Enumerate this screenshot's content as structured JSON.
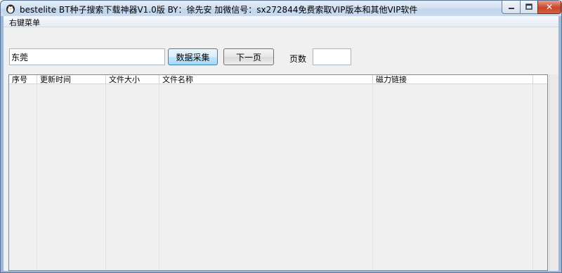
{
  "window": {
    "title": "bestelite BT种子搜索下载神器V1.0版  BY：徐先安   加微信号：sx272844免费索取VIP版本和其他VIP软件",
    "buttons": {
      "close": "✕"
    }
  },
  "menu": {
    "items": [
      "右键菜单"
    ]
  },
  "toolbar": {
    "search_value": "东莞",
    "collect_label": "数据采集",
    "next_label": "下一页",
    "page_label": "页数",
    "page_value": ""
  },
  "table": {
    "columns": [
      "序号",
      "更新时间",
      "文件大小",
      "文件名称",
      "磁力链接"
    ],
    "rows": []
  }
}
